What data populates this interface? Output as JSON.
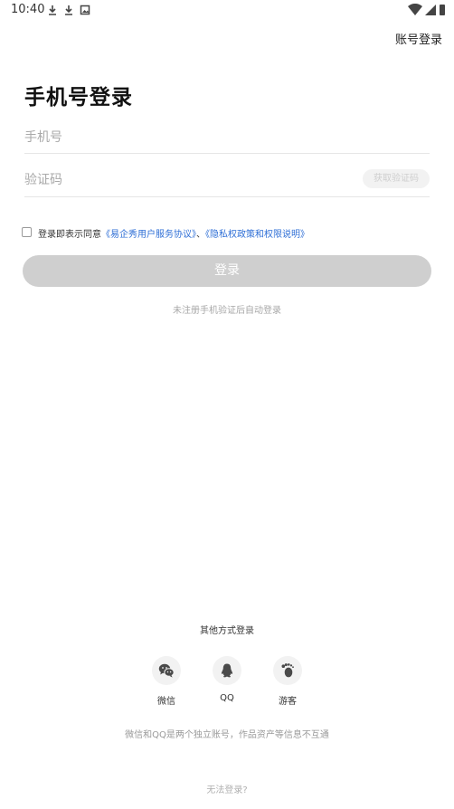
{
  "status_bar": {
    "time": "10:40"
  },
  "header": {
    "account_login": "账号登录"
  },
  "title": "手机号登录",
  "phone_field": {
    "placeholder": "手机号"
  },
  "code_field": {
    "placeholder": "验证码",
    "get_code_label": "获取验证码"
  },
  "agreement": {
    "prefix": "登录即表示同意",
    "user_agreement": "《易企秀用户服务协议》",
    "separator": "、",
    "privacy_policy": "《隐私权政策和权限说明》"
  },
  "login_button": "登录",
  "auto_register_hint": "未注册手机验证后自动登录",
  "other_methods": {
    "title": "其他方式登录",
    "items": [
      {
        "label": "微信",
        "icon": "wechat-icon"
      },
      {
        "label": "QQ",
        "icon": "qq-icon"
      },
      {
        "label": "游客",
        "icon": "guest-footprint-icon"
      }
    ]
  },
  "disclaimer": "微信和QQ是两个独立账号，作品资产等信息不互通",
  "cant_login": "无法登录?",
  "colors": {
    "link": "#2f6fd6",
    "button_disabled": "#cfcfcf",
    "icon_gray": "#4a4a4a"
  }
}
